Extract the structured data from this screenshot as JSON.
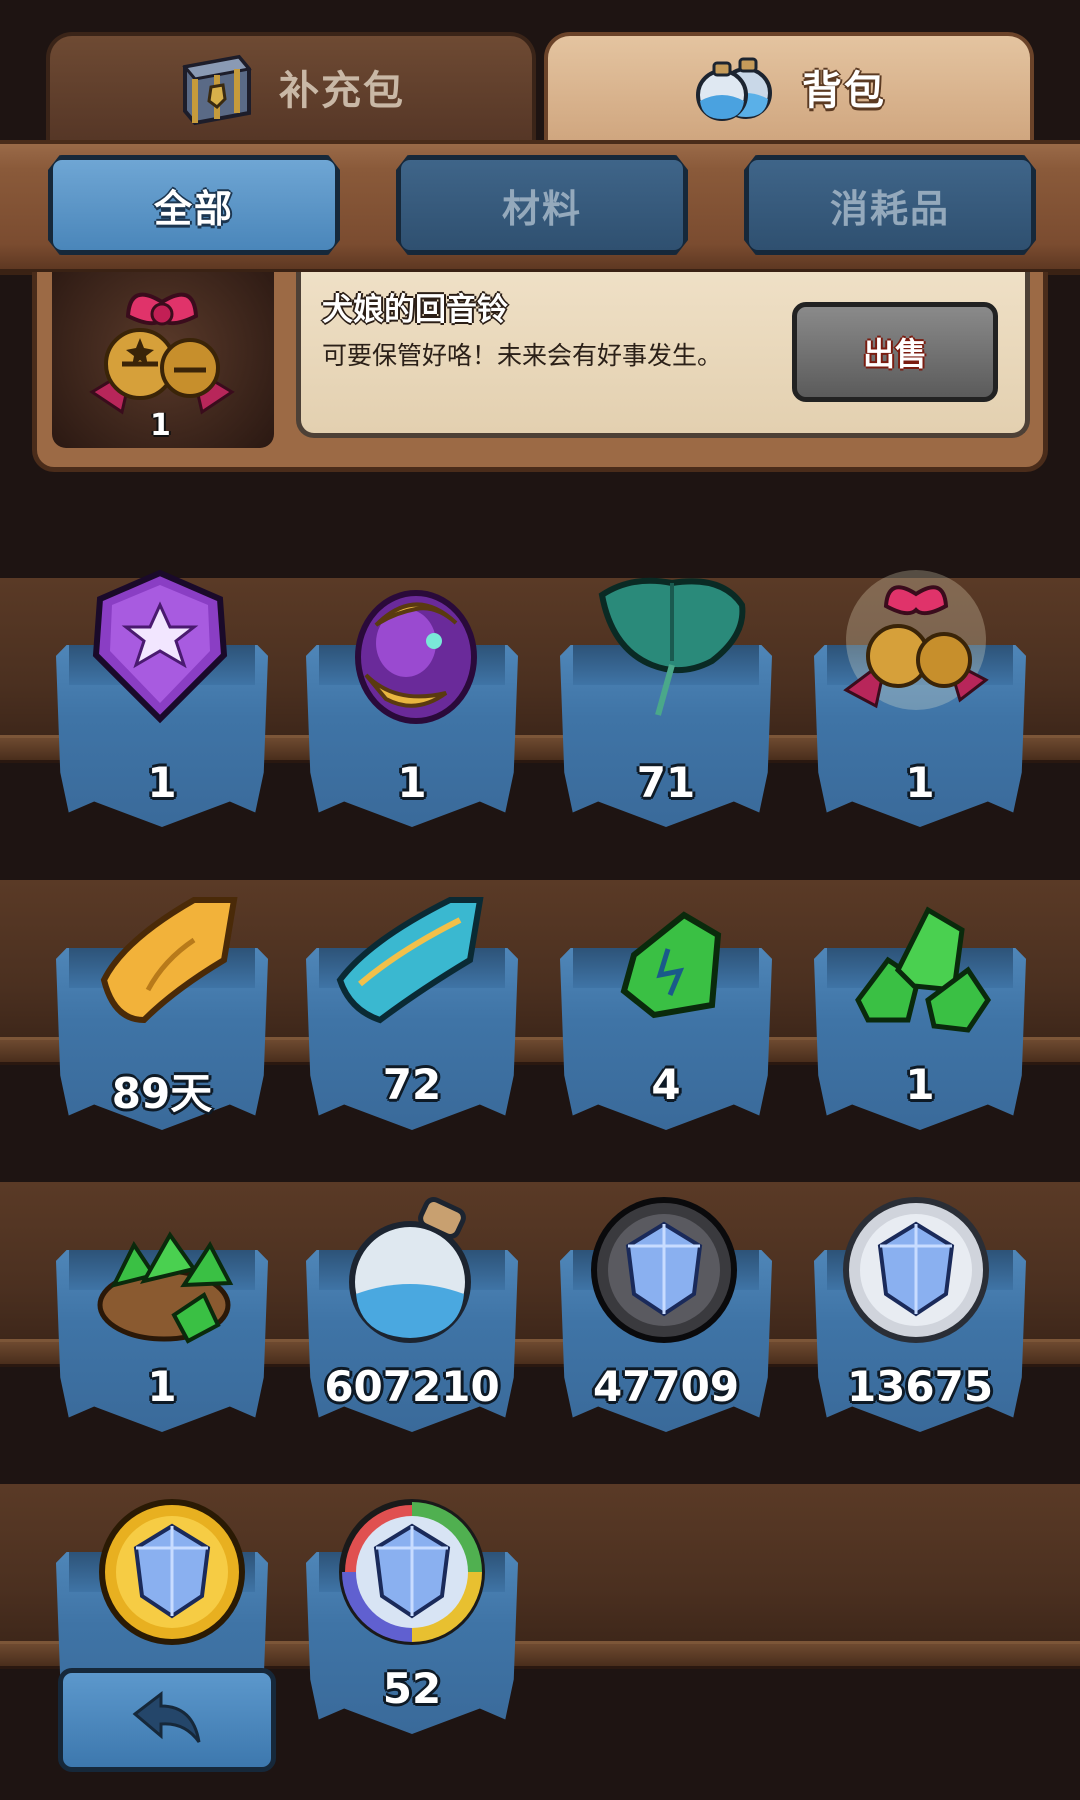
{
  "tabs": [
    {
      "label": "补充包",
      "icon": "treasure-chest-icon",
      "active": false
    },
    {
      "label": "背包",
      "icon": "potion-bottles-icon",
      "active": true
    }
  ],
  "filters": [
    {
      "label": "全部",
      "active": true
    },
    {
      "label": "材料",
      "active": false
    },
    {
      "label": "消耗品",
      "active": false
    }
  ],
  "selected_item": {
    "name": "犬娘的回音铃",
    "description": "可要保管好咯！未来会有好事发生。",
    "count": "1",
    "icon": "jingle-bells-icon",
    "sell_label": "出售"
  },
  "items": [
    {
      "icon": "purple-star-gem-icon",
      "count": "1"
    },
    {
      "icon": "golden-purple-egg-icon",
      "count": "1"
    },
    {
      "icon": "lotus-leaf-icon",
      "count": "71"
    },
    {
      "icon": "jingle-bells-icon",
      "count": "1"
    },
    {
      "icon": "golden-ticket-icon",
      "count": "89天"
    },
    {
      "icon": "blue-ticket-icon",
      "count": "72"
    },
    {
      "icon": "green-crystal-icon",
      "count": "4"
    },
    {
      "icon": "green-crystal-pile-icon",
      "count": "1"
    },
    {
      "icon": "green-crystal-sack-icon",
      "count": "1"
    },
    {
      "icon": "blue-sand-bottle-icon",
      "count": "607210"
    },
    {
      "icon": "black-gem-coin-icon",
      "count": "47709"
    },
    {
      "icon": "silver-gem-coin-icon",
      "count": "13675"
    },
    {
      "icon": "gold-gem-coin-icon",
      "count": ""
    },
    {
      "icon": "rainbow-gem-coin-icon",
      "count": "52"
    }
  ],
  "back_button_icon": "back-arrow-icon"
}
